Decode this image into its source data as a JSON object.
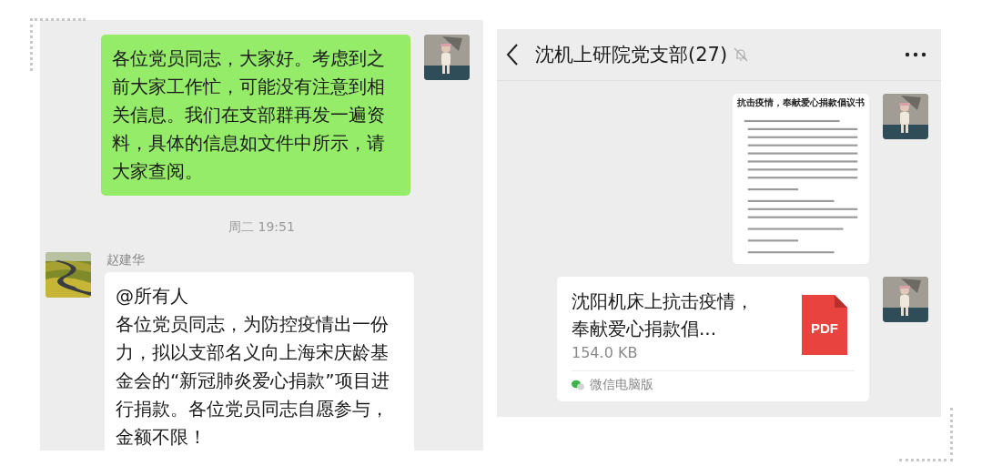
{
  "left_chat": {
    "messages": [
      {
        "kind": "outgoing",
        "text": "各位党员同志，大家好。考虑到之前大家工作忙，可能没有注意到相关信息。我们在支部群再发一遍资料，具体的信息如文件中所示，请大家查阅。"
      },
      {
        "kind": "timestamp",
        "text": "周二 19:51"
      },
      {
        "kind": "incoming",
        "sender": "赵建华",
        "mention": "@所有人",
        "text": "各位党员同志，为防控疫情出一份力，拟以支部名义向上海宋庆龄基金会的“新冠肺炎爱心捐款”项目进行捐款。各位党员同志自愿参与，金额不限！"
      }
    ]
  },
  "right_chat": {
    "title": "沈机上研院党支部(27)",
    "muted": true,
    "messages": [
      {
        "kind": "document_image",
        "title": "抗击疫情，奉献爱心捐款倡议书"
      },
      {
        "kind": "file",
        "name": "沈阳机床上抗击疫情，奉献爱心捐款倡...",
        "size": "154.0 KB",
        "file_type": "PDF",
        "source": "微信电脑版"
      }
    ]
  }
}
